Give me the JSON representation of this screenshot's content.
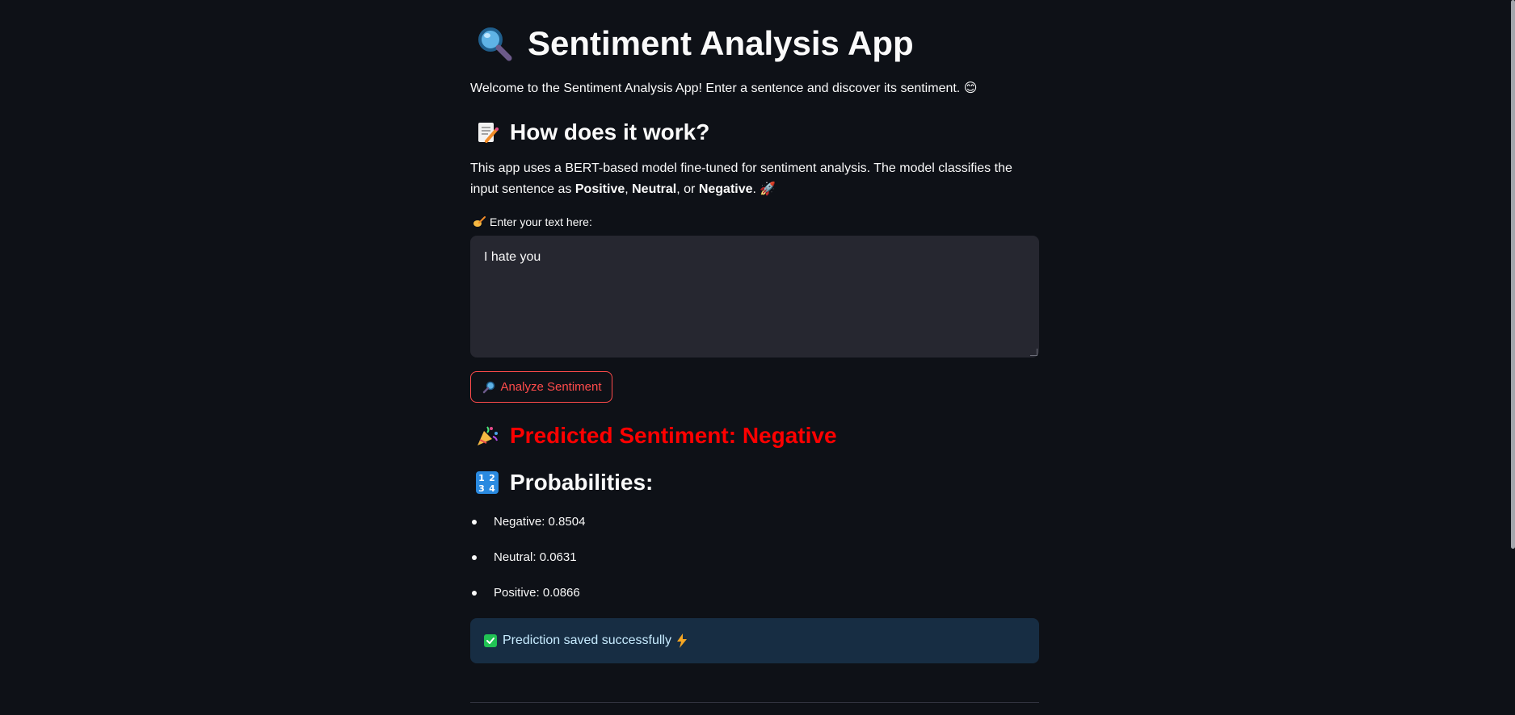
{
  "app": {
    "title": "Sentiment Analysis App",
    "welcome": "Welcome to the Sentiment Analysis App! Enter a sentence and discover its sentiment. 😊"
  },
  "how": {
    "heading": "How does it work?",
    "text_before": "This app uses a BERT-based model fine-tuned for sentiment analysis. The model classifies the input sentence as ",
    "positive": "Positive",
    "sep1": ", ",
    "neutral": "Neutral",
    "sep2": ", or ",
    "negative": "Negative",
    "text_after": ". 🚀"
  },
  "input": {
    "label": "Enter your text here:",
    "value": "I hate you"
  },
  "analyze_button": {
    "label": "Analyze Sentiment"
  },
  "result": {
    "predicted_label": "Predicted Sentiment: Negative",
    "probabilities_heading": "Probabilities:",
    "probabilities": [
      "Negative: 0.8504",
      "Neutral: 0.0631",
      "Positive: 0.0866"
    ]
  },
  "alert": {
    "message": "Prediction saved successfully"
  },
  "icons": {
    "title": "magnifying-glass-icon",
    "how": "memo-icon",
    "label": "writing-hand-icon",
    "button": "magnifying-glass-icon",
    "predicted": "party-popper-icon",
    "probabilities": "numbers-1234-icon",
    "alert_check": "check-mark-button-icon",
    "alert_bolt": "lightning-icon"
  },
  "colors": {
    "background": "#0e1117",
    "accent": "#ff4b4b",
    "negative_prediction": "#ff0000",
    "info_bg": "#172d43",
    "success_check": "#21c354"
  }
}
